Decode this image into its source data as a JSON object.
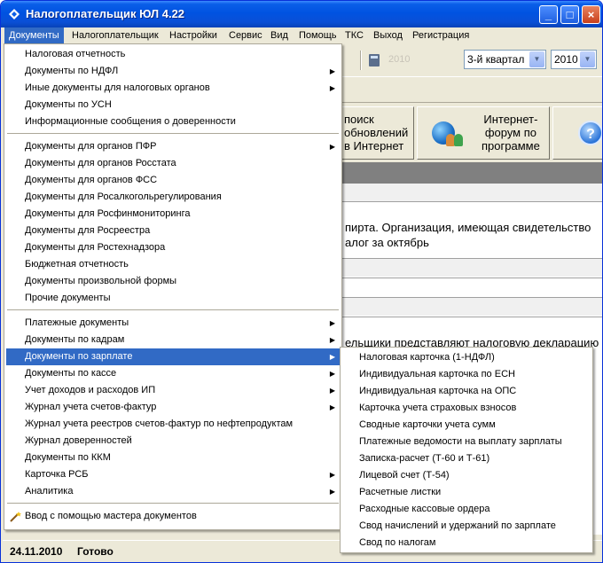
{
  "window": {
    "title": "Налогоплательщик ЮЛ 4.22"
  },
  "menubar": [
    {
      "label": "Документы",
      "active": true
    },
    {
      "label": "Налогоплательщик"
    },
    {
      "label": "Настройки"
    },
    {
      "label": "Сервис"
    },
    {
      "label": "Вид"
    },
    {
      "label": "Помощь"
    },
    {
      "label": "ТКС"
    },
    {
      "label": "Выход"
    },
    {
      "label": "Регистрация"
    }
  ],
  "toolbar": {
    "year_faded": "2010",
    "quarter": "3-й квартал",
    "year": "2010"
  },
  "big_buttons": {
    "update": "поиск\nобновлений\nв Интернет",
    "forum": "Интернет-\nфорум по\nпрограмме"
  },
  "content": {
    "line1": "пирта. Организация, имеющая свидетельство",
    "line2": "алог за октябрь",
    "line3": "ельщики представляют налоговую декларацию"
  },
  "documents_menu": [
    {
      "label": "Налоговая отчетность"
    },
    {
      "label": "Документы по НДФЛ",
      "submenu": true
    },
    {
      "label": "Иные документы для налоговых органов",
      "submenu": true
    },
    {
      "label": "Документы по УСН"
    },
    {
      "label": "Информационные сообщения о доверенности"
    },
    {
      "label": "Документы для органов ПФР",
      "submenu": true
    },
    {
      "label": "Документы для органов Росстата"
    },
    {
      "label": "Документы для органов ФСС"
    },
    {
      "label": "Документы для Росалкогольрегулирования"
    },
    {
      "label": "Документы для Росфинмониторинга"
    },
    {
      "label": "Документы для Росреестра"
    },
    {
      "label": "Документы для Ростехнадзора"
    },
    {
      "label": "Бюджетная отчетность"
    },
    {
      "label": "Документы произвольной формы"
    },
    {
      "label": "Прочие документы"
    },
    {
      "label": "Платежные документы",
      "submenu": true
    },
    {
      "label": "Документы по кадрам",
      "submenu": true
    },
    {
      "label": "Документы по зарплате",
      "submenu": true,
      "highlighted": true
    },
    {
      "label": "Документы по кассе",
      "submenu": true
    },
    {
      "label": "Учет доходов и расходов ИП",
      "submenu": true
    },
    {
      "label": "Журнал учета счетов-фактур",
      "submenu": true
    },
    {
      "label": "Журнал учета реестров счетов-фактур по нефтепродуктам"
    },
    {
      "label": "Журнал доверенностей"
    },
    {
      "label": "Документы по ККМ"
    },
    {
      "label": "Карточка РСБ",
      "submenu": true
    },
    {
      "label": "Аналитика",
      "submenu": true
    },
    {
      "label": "Ввод с помощью мастера документов",
      "icon": "wand-icon"
    }
  ],
  "salary_submenu": [
    {
      "label": "Налоговая карточка (1-НДФЛ)"
    },
    {
      "label": "Индивидуальная карточка по ЕСН"
    },
    {
      "label": "Индивидуальная карточка на ОПС"
    },
    {
      "label": "Карточка учета страховых взносов"
    },
    {
      "label": "Сводные карточки учета сумм"
    },
    {
      "label": "Платежные ведомости на выплату зарплаты"
    },
    {
      "label": "Записка-расчет (Т-60 и Т-61)"
    },
    {
      "label": "Лицевой счет (Т-54)"
    },
    {
      "label": "Расчетные листки"
    },
    {
      "label": "Расходные кассовые ордера"
    },
    {
      "label": "Свод начислений и удержаний по зарплате"
    },
    {
      "label": "Свод по налогам"
    }
  ],
  "status": {
    "date": "24.11.2010",
    "text": "Готово"
  },
  "colors": {
    "highlight": "#316ac5",
    "titlebar": "#0053e1",
    "face": "#ece9d8"
  }
}
